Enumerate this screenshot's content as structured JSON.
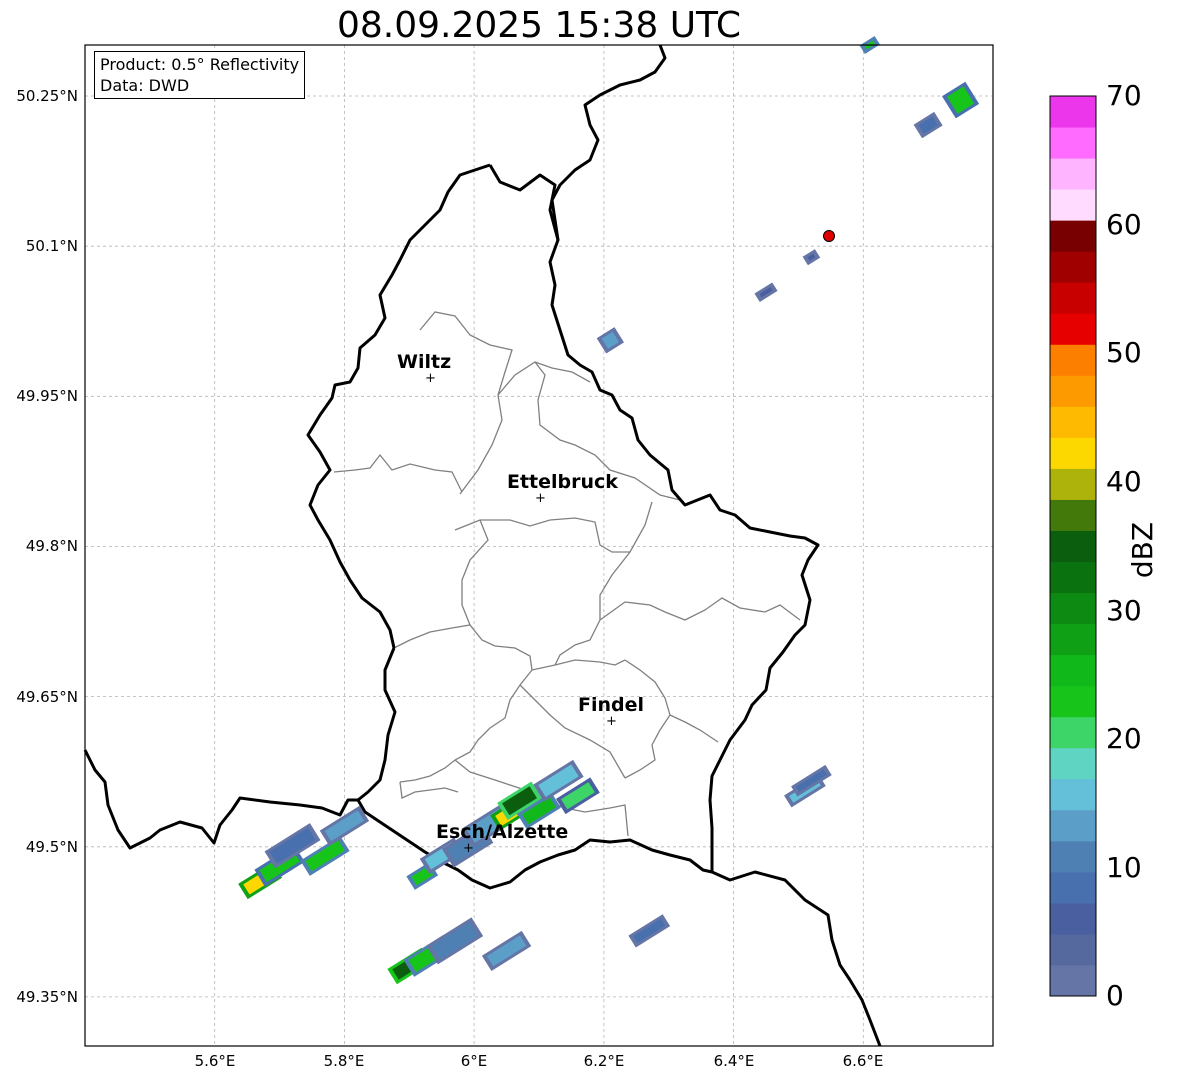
{
  "title": "08.09.2025 15:38 UTC",
  "info_box": {
    "product": "Product: 0.5° Reflectivity",
    "data": "Data: DWD"
  },
  "x_ticks": [
    "5.6°E",
    "5.8°E",
    "6°E",
    "6.2°E",
    "6.4°E",
    "6.6°E"
  ],
  "y_ticks": [
    "50.25°N",
    "50.1°N",
    "49.95°N",
    "49.8°N",
    "49.65°N",
    "49.5°N",
    "49.35°N"
  ],
  "extent": {
    "lon": [
      5.4,
      6.8
    ],
    "lat": [
      49.3,
      50.3
    ]
  },
  "cities": [
    {
      "name": "Wiltz",
      "lon": 5.93,
      "lat": 49.97
    },
    {
      "name": "Ettelbruck",
      "lon": 6.1,
      "lat": 49.85
    },
    {
      "name": "Findel",
      "lon": 6.21,
      "lat": 49.627
    },
    {
      "name": "Esch/Alzette",
      "lon": 5.99,
      "lat": 49.5
    }
  ],
  "radar_site": {
    "lon": 6.548,
    "lat": 50.11,
    "color": "#e00000"
  },
  "colorbar": {
    "label": "dBZ",
    "ticks": [
      "0",
      "10",
      "20",
      "30",
      "40",
      "50",
      "60",
      "70"
    ],
    "colors": [
      "#6475a6",
      "#56699f",
      "#4a5fa0",
      "#4870ae",
      "#4f80b4",
      "#5b9fc8",
      "#64bfd9",
      "#5fd4c2",
      "#3dd468",
      "#16c41a",
      "#10b81a",
      "#0fa015",
      "#0d8a12",
      "#0b7210",
      "#0a5e0d",
      "#43780b",
      "#aeb30b",
      "#fdd700",
      "#fdba00",
      "#fd9a00",
      "#fd7f00",
      "#e60000",
      "#c80000",
      "#a00000",
      "#780000",
      "#ffdcff",
      "#ffb4ff",
      "#ff6bff",
      "#ec36ec"
    ]
  },
  "echoes": [
    {
      "lon": 5.67,
      "lat": 49.465,
      "dbz": 42,
      "len": 0.05,
      "w": 0.012
    },
    {
      "lon": 5.7,
      "lat": 49.48,
      "dbz": 22,
      "len": 0.06,
      "w": 0.014
    },
    {
      "lon": 5.72,
      "lat": 49.5,
      "dbz": 8,
      "len": 0.07,
      "w": 0.014
    },
    {
      "lon": 5.77,
      "lat": 49.49,
      "dbz": 24,
      "len": 0.06,
      "w": 0.012
    },
    {
      "lon": 5.8,
      "lat": 49.52,
      "dbz": 14,
      "len": 0.06,
      "w": 0.012
    },
    {
      "lon": 5.92,
      "lat": 49.47,
      "dbz": 24,
      "len": 0.03,
      "w": 0.01
    },
    {
      "lon": 5.95,
      "lat": 49.49,
      "dbz": 16,
      "len": 0.05,
      "w": 0.012
    },
    {
      "lon": 5.99,
      "lat": 49.5,
      "dbz": 12,
      "len": 0.06,
      "w": 0.016
    },
    {
      "lon": 6.02,
      "lat": 49.52,
      "dbz": 14,
      "len": 0.06,
      "w": 0.016
    },
    {
      "lon": 6.05,
      "lat": 49.53,
      "dbz": 42,
      "len": 0.03,
      "w": 0.012
    },
    {
      "lon": 6.07,
      "lat": 49.545,
      "dbz": 34,
      "len": 0.05,
      "w": 0.014
    },
    {
      "lon": 6.1,
      "lat": 49.535,
      "dbz": 25,
      "len": 0.05,
      "w": 0.012
    },
    {
      "lon": 6.13,
      "lat": 49.565,
      "dbz": 16,
      "len": 0.06,
      "w": 0.014
    },
    {
      "lon": 6.16,
      "lat": 49.55,
      "dbz": 20,
      "len": 0.05,
      "w": 0.012
    },
    {
      "lon": 5.9,
      "lat": 49.38,
      "dbz": 36,
      "len": 0.05,
      "w": 0.012
    },
    {
      "lon": 5.93,
      "lat": 49.39,
      "dbz": 24,
      "len": 0.06,
      "w": 0.014
    },
    {
      "lon": 5.97,
      "lat": 49.405,
      "dbz": 12,
      "len": 0.07,
      "w": 0.016
    },
    {
      "lon": 6.05,
      "lat": 49.395,
      "dbz": 14,
      "len": 0.06,
      "w": 0.012
    },
    {
      "lon": 6.27,
      "lat": 49.415,
      "dbz": 8,
      "len": 0.05,
      "w": 0.008
    },
    {
      "lon": 6.51,
      "lat": 49.555,
      "dbz": 16,
      "len": 0.05,
      "w": 0.008
    },
    {
      "lon": 6.52,
      "lat": 49.565,
      "dbz": 8,
      "len": 0.05,
      "w": 0.006
    },
    {
      "lon": 6.21,
      "lat": 50.005,
      "dbz": 14,
      "len": 0.02,
      "w": 0.012
    },
    {
      "lon": 6.45,
      "lat": 50.053,
      "dbz": 6,
      "len": 0.02,
      "w": 0.004
    },
    {
      "lon": 6.52,
      "lat": 50.088,
      "dbz": 6,
      "len": 0.01,
      "w": 0.003
    },
    {
      "lon": 6.7,
      "lat": 50.22,
      "dbz": 8,
      "len": 0.025,
      "w": 0.01
    },
    {
      "lon": 6.75,
      "lat": 50.245,
      "dbz": 22,
      "len": 0.03,
      "w": 0.02
    },
    {
      "lon": 6.61,
      "lat": 50.3,
      "dbz": 24,
      "len": 0.015,
      "w": 0.004
    }
  ]
}
